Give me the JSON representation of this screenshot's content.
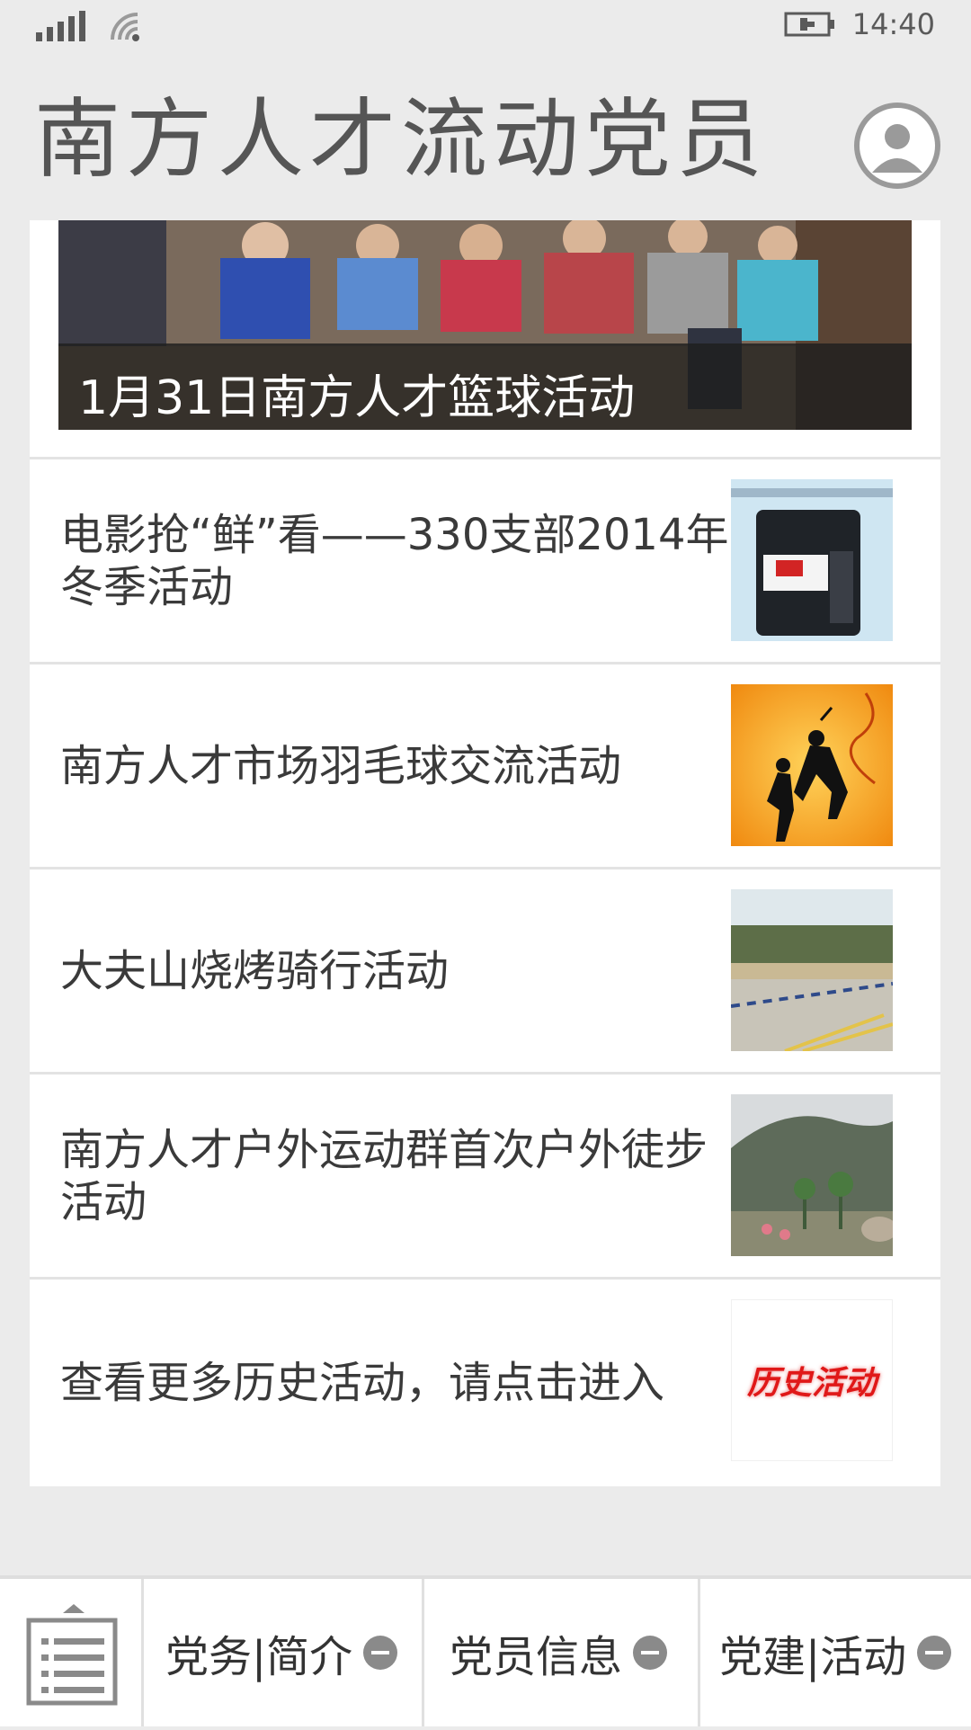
{
  "status_bar": {
    "time": "14:40"
  },
  "header": {
    "title": "南方人才流动党员"
  },
  "banner": {
    "caption": "1月31日南方人才篮球活动"
  },
  "news": [
    {
      "title": "电影抢“鲜”看——330支部2014年冬季活动",
      "thumb_icon": "screenshot-thumbnail"
    },
    {
      "title": "南方人才市场羽毛球交流活动",
      "thumb_icon": "badminton-thumbnail"
    },
    {
      "title": "大夫山烧烤骑行活动",
      "thumb_icon": "park-thumbnail"
    },
    {
      "title": "南方人才户外运动群首次户外徒步活动",
      "thumb_icon": "mountain-thumbnail"
    },
    {
      "title": "查看更多历史活动，请点击进入",
      "thumb_icon": "history-logo-thumbnail",
      "thumb_text": "历史活动"
    }
  ],
  "bottom_nav": {
    "items": [
      {
        "label": "党务|简介"
      },
      {
        "label": "党员信息"
      },
      {
        "label": "党建|活动"
      }
    ]
  },
  "colors": {
    "accent_red": "#e01818",
    "nav_icon": "#8a8a8a"
  }
}
